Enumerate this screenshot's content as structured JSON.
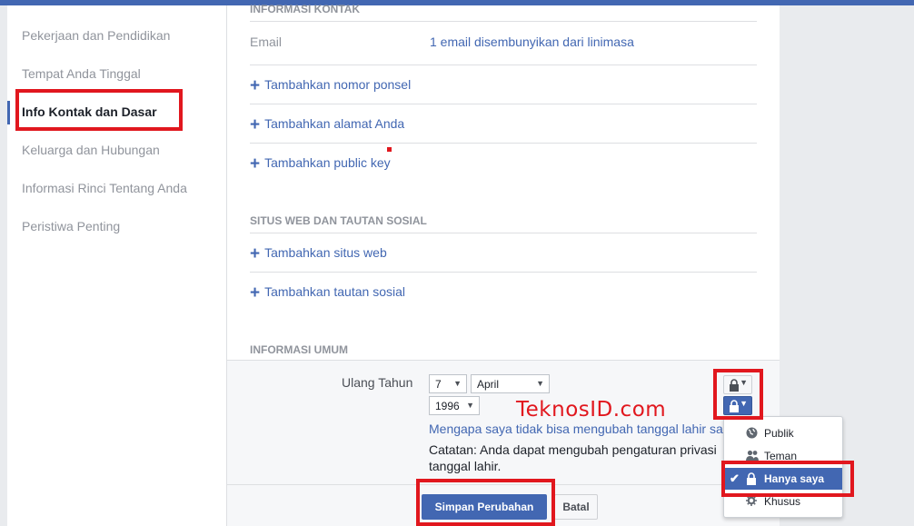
{
  "sidebar": {
    "items": [
      {
        "label": "Pekerjaan dan Pendidikan"
      },
      {
        "label": "Tempat Anda Tinggal"
      },
      {
        "label": "Info Kontak dan Dasar"
      },
      {
        "label": "Keluarga dan Hubungan"
      },
      {
        "label": "Informasi Rinci Tentang Anda"
      },
      {
        "label": "Peristiwa Penting"
      }
    ],
    "active_index": 2
  },
  "contact": {
    "title": "INFORMASI KONTAK",
    "email_label": "Email",
    "email_value": "1 email disembunyikan dari linimasa",
    "links": [
      "Tambahkan nomor ponsel",
      "Tambahkan alamat Anda",
      "Tambahkan public key"
    ]
  },
  "websites": {
    "title": "SITUS WEB DAN TAUTAN SOSIAL",
    "links": [
      "Tambahkan situs web",
      "Tambahkan tautan sosial"
    ]
  },
  "general": {
    "title": "INFORMASI UMUM",
    "birthday_label": "Ulang Tahun",
    "day": "7",
    "month": "April",
    "year": "1996",
    "why_link": "Mengapa saya tidak bisa mengubah tanggal lahir sa",
    "note_line1": "Catatan: Anda dapat mengubah pengaturan privasi",
    "note_line2": "tanggal lahir.",
    "save_label": "Simpan Perubahan",
    "cancel_label": "Batal"
  },
  "privacy_menu": {
    "items": [
      {
        "label": "Publik",
        "icon": "globe-icon"
      },
      {
        "label": "Teman",
        "icon": "friends-icon"
      },
      {
        "label": "Hanya saya",
        "icon": "lock-icon",
        "selected": true
      },
      {
        "label": "Khusus",
        "icon": "gear-icon"
      }
    ]
  },
  "watermark": "TeknosID.com",
  "colors": {
    "accent": "#4267b2",
    "highlight": "#e1171e"
  }
}
